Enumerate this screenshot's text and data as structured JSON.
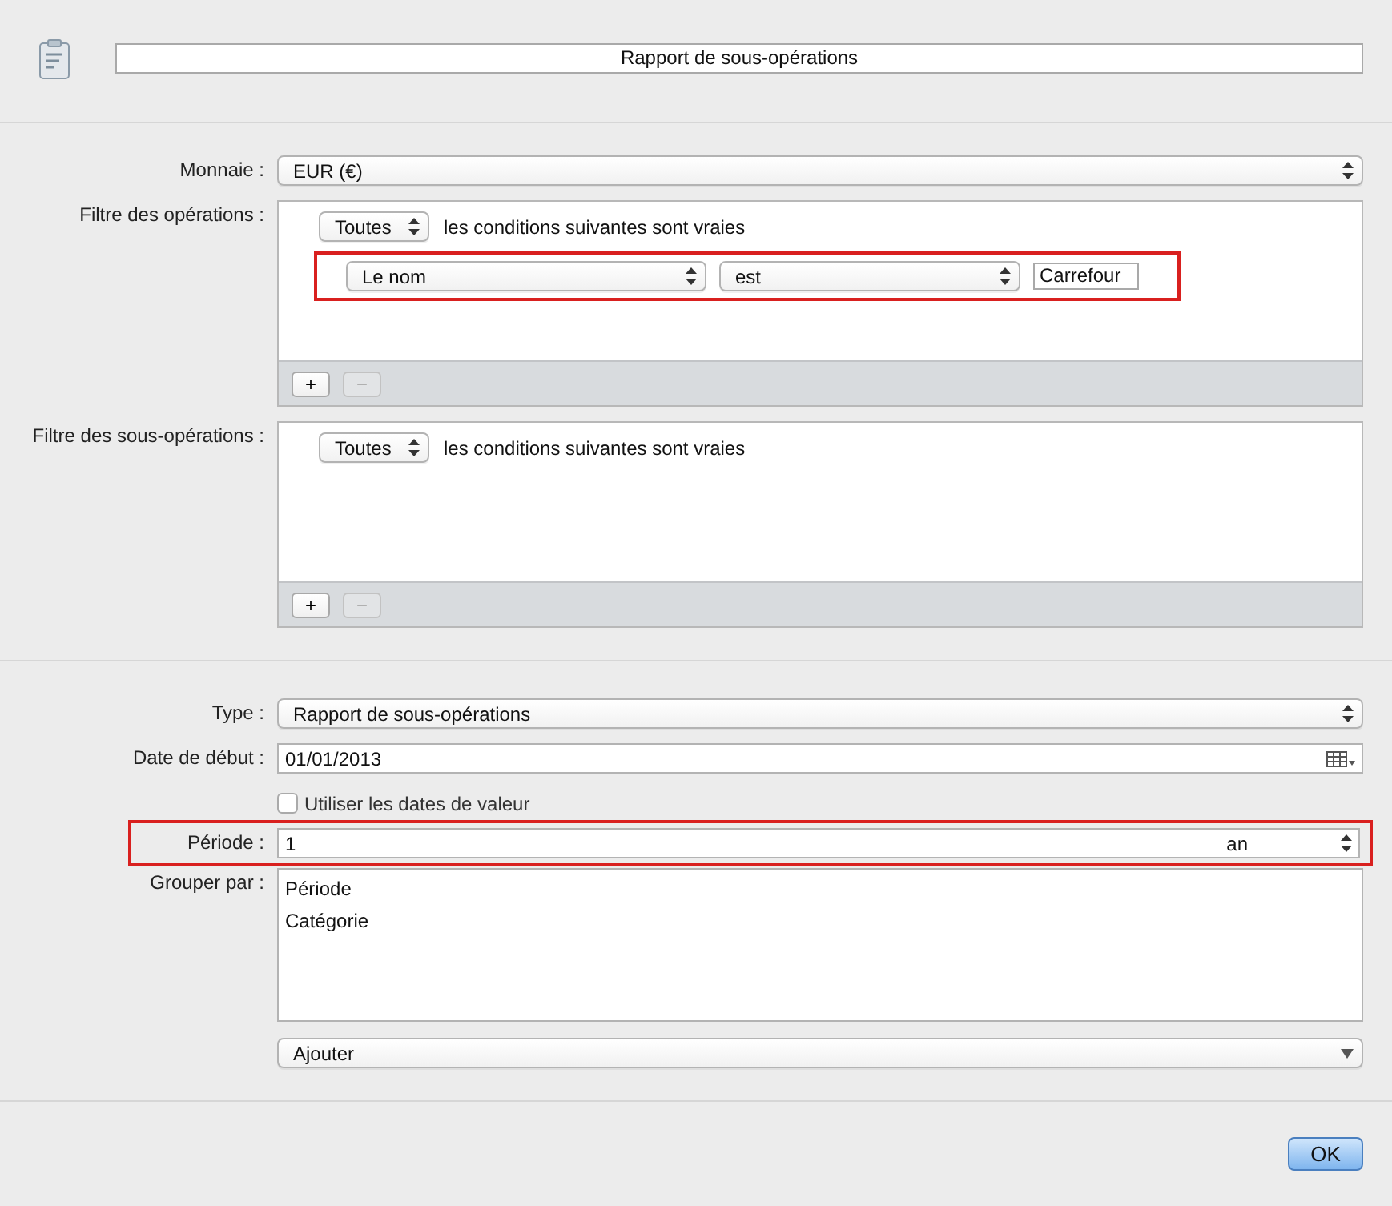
{
  "title_field": {
    "value": "Rapport de sous-opérations"
  },
  "currency": {
    "label": "Monnaie :",
    "value": "EUR (€)"
  },
  "filters": [
    {
      "label": "Filtre des opérations :",
      "match": "Toutes",
      "match_text": "les conditions suivantes sont vraies",
      "conditions": [
        {
          "field": "Le nom",
          "operator": "est",
          "value": "Carrefour",
          "highlighted": true
        }
      ],
      "add": "+",
      "remove": "−",
      "remove_disabled": true
    },
    {
      "label": "Filtre des sous-opérations :",
      "match": "Toutes",
      "match_text": "les conditions suivantes sont vraies",
      "add": "+",
      "remove": "−",
      "remove_disabled": true
    }
  ],
  "report": {
    "type": {
      "label": "Type :",
      "value": "Rapport de sous-opérations"
    },
    "start_date": {
      "label": "Date de début :",
      "value": "01/01/2013"
    },
    "value_dates": {
      "label": "Utiliser les dates de valeur",
      "checked": false
    },
    "period": {
      "label": "Période :",
      "value": "1",
      "unit": "an",
      "highlighted": true
    },
    "group_by": {
      "label": "Grouper par :",
      "items": [
        "Période",
        "Catégorie"
      ]
    },
    "add_menu": {
      "value": "Ajouter"
    }
  },
  "ok_button": "OK"
}
